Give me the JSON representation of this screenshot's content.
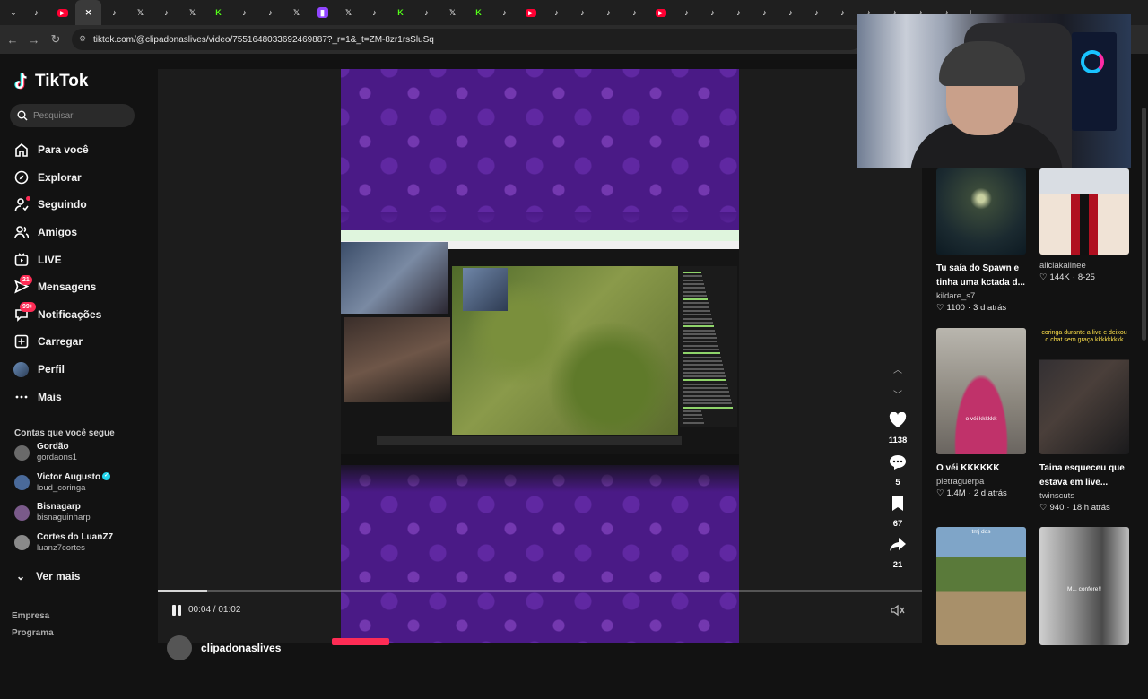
{
  "browser": {
    "tabs": [
      "tiktok",
      "youtube",
      "tiktok-active",
      "tiktok",
      "x",
      "tiktok",
      "x",
      "kick",
      "tiktok",
      "tiktok",
      "x",
      "twitch",
      "x",
      "tiktok",
      "kick",
      "tiktok",
      "x",
      "kick",
      "tiktok",
      "youtube",
      "tiktok",
      "tiktok",
      "tiktok",
      "tiktok",
      "youtube",
      "tiktok",
      "tiktok",
      "tiktok",
      "tiktok",
      "tiktok",
      "tiktok",
      "tiktok",
      "tiktok",
      "tiktok",
      "tiktok",
      "tiktok"
    ],
    "url": "tiktok.com/@clipadonaslives/video/7551648033692469887?_r=1&_t=ZM-8zr1rsSluSq"
  },
  "sidebar": {
    "logo": "TikTok",
    "search_placeholder": "Pesquisar",
    "nav": [
      {
        "label": "Para você",
        "icon": "home-icon"
      },
      {
        "label": "Explorar",
        "icon": "compass-icon"
      },
      {
        "label": "Seguindo",
        "icon": "following-icon"
      },
      {
        "label": "Amigos",
        "icon": "friends-icon"
      },
      {
        "label": "LIVE",
        "icon": "live-icon"
      },
      {
        "label": "Mensagens",
        "icon": "messages-icon",
        "badge": "21"
      },
      {
        "label": "Notificações",
        "icon": "notifications-icon",
        "badge": "99+"
      },
      {
        "label": "Carregar",
        "icon": "upload-icon"
      },
      {
        "label": "Perfil",
        "icon": "profile-avatar"
      },
      {
        "label": "Mais",
        "icon": "more-icon"
      }
    ],
    "following_title": "Contas que você segue",
    "following": [
      {
        "name": "Gordão",
        "user": "gordaons1"
      },
      {
        "name": "Victor Augusto",
        "user": "loud_coringa",
        "verified": true
      },
      {
        "name": "Bisnagarp",
        "user": "bisnaguinharp"
      },
      {
        "name": "Cortes do LuanZ7",
        "user": "luanz7cortes"
      }
    ],
    "see_more": "Ver mais",
    "footer": [
      "Empresa",
      "Programa"
    ]
  },
  "video": {
    "time": "00:04 / 01:02",
    "progress": 0.065,
    "author": "clipadonaslives"
  },
  "actions": {
    "likes": "1138",
    "comments": "5",
    "saves": "67",
    "shares": "21"
  },
  "recommendations": [
    {
      "title": "Tu saía do Spawn e tinha uma kctada d...",
      "user": "kildare_s7",
      "likes": "1100",
      "age": "3 d atrás"
    },
    {
      "title": "",
      "user": "aliciakalinee",
      "likes": "144K",
      "age": "8-25"
    },
    {
      "title": "O véi KKKKKK",
      "user": "pietraguerpa",
      "likes": "1.4M",
      "age": "2 d atrás",
      "overlay": "o véi kkkkkk"
    },
    {
      "title": "Taina esqueceu que estava em live...",
      "user": "twinscuts",
      "likes": "940",
      "age": "18 h atrás",
      "overlay": "coringa durante a live e deixou o chat sem graça kkkkkkkkk"
    },
    {
      "title": "",
      "user": "",
      "likes": "",
      "age": "",
      "overlay": "tmj dos"
    },
    {
      "title": "",
      "user": "",
      "likes": "",
      "age": "",
      "overlay": "M... confere!!"
    }
  ],
  "colors": {
    "accent": "#fe2c55",
    "background": "#121212",
    "video_bg": "#4a1a86"
  }
}
